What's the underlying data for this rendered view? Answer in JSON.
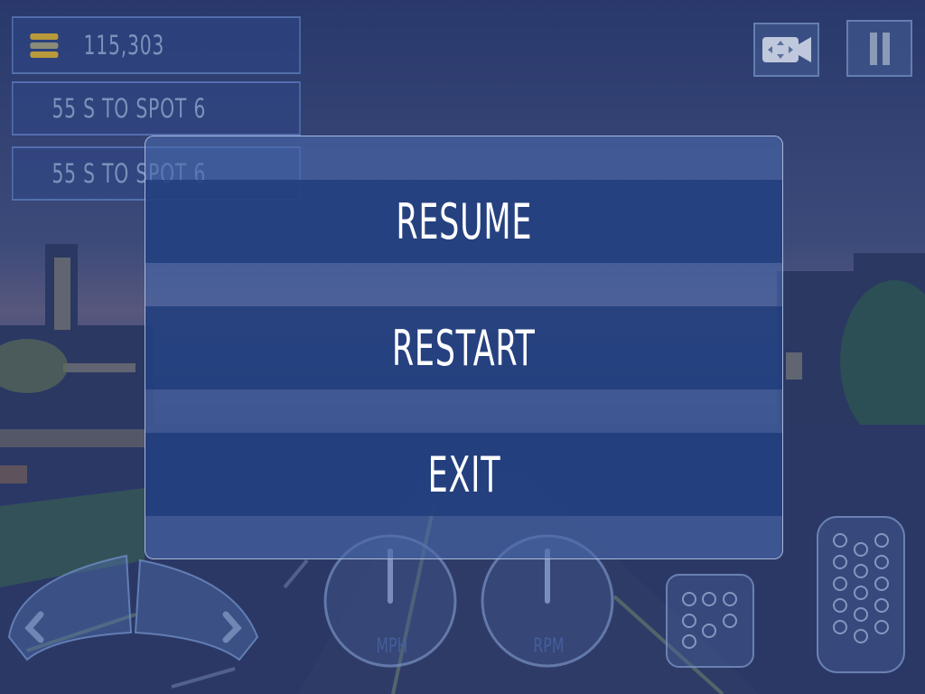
{
  "hud": {
    "score": "115,303",
    "timer_primary": "55 S TO SPOT 6",
    "timer_secondary": "55 S TO SPOT 6"
  },
  "pause_menu": {
    "resume_label": "RESUME",
    "restart_label": "RESTART",
    "exit_label": "EXIT"
  },
  "gauges": {
    "speed_label": "MPH",
    "rpm_label": "RPM"
  },
  "icons": {
    "score": "stack-icon",
    "camera": "camera-switch-icon",
    "pause": "pause-icon",
    "steer_left": "steer-left-arrow-icon",
    "steer_right": "steer-right-arrow-icon",
    "brake": "brake-pedal-icon",
    "gas": "gas-pedal-icon"
  },
  "colors": {
    "menu_button": "#1e3a78",
    "menu_panel": "#4868aa",
    "text": "#ffffff"
  }
}
